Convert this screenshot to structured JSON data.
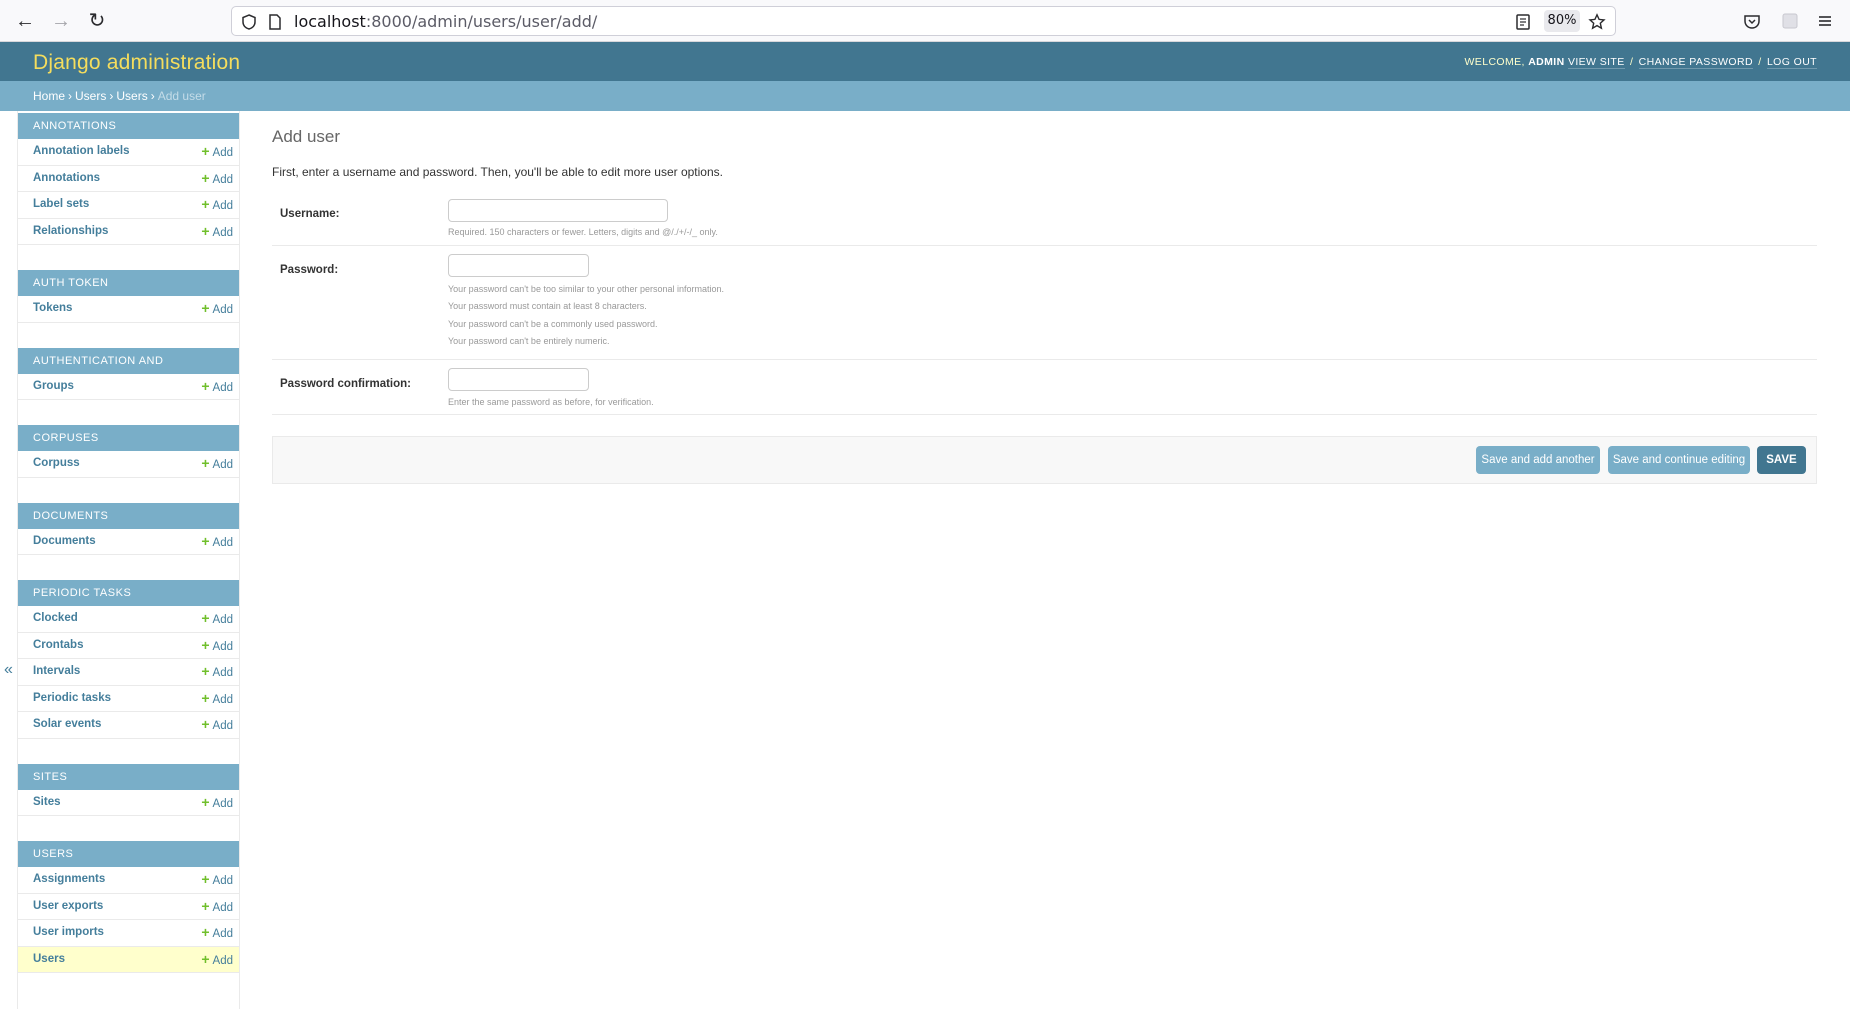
{
  "browser": {
    "url_host": "localhost",
    "url_path": ":8000/admin/users/user/add/",
    "zoom": "80%"
  },
  "header": {
    "branding": "Django administration",
    "welcome": "WELCOME,",
    "username": "ADMIN",
    "view_site": "VIEW SITE",
    "change_password": "CHANGE PASSWORD",
    "log_out": "LOG OUT",
    "sep": "/"
  },
  "breadcrumbs": {
    "home": "Home",
    "app": "Users",
    "model": "Users",
    "current": "Add user",
    "sep": "›"
  },
  "sidebar": {
    "collapse_glyph": "«",
    "add_label": "Add",
    "modules": [
      {
        "caption": "ANNOTATIONS",
        "items": [
          "Annotation labels",
          "Annotations",
          "Label sets",
          "Relationships"
        ]
      },
      {
        "caption": "AUTH TOKEN",
        "items": [
          "Tokens"
        ]
      },
      {
        "caption": "AUTHENTICATION AND AUTHORIZATION",
        "items": [
          "Groups"
        ]
      },
      {
        "caption": "CORPUSES",
        "items": [
          "Corpuss"
        ]
      },
      {
        "caption": "DOCUMENTS",
        "items": [
          "Documents"
        ]
      },
      {
        "caption": "PERIODIC TASKS",
        "items": [
          "Clocked",
          "Crontabs",
          "Intervals",
          "Periodic tasks",
          "Solar events"
        ]
      },
      {
        "caption": "SITES",
        "items": [
          "Sites"
        ]
      },
      {
        "caption": "USERS",
        "items": [
          "Assignments",
          "User exports",
          "User imports",
          "Users"
        ]
      }
    ],
    "current_item": "Users"
  },
  "main": {
    "title": "Add user",
    "intro": "First, enter a username and password. Then, you'll be able to edit more user options.",
    "username": {
      "label": "Username:",
      "value": "",
      "help": "Required. 150 characters or fewer. Letters, digits and @/./+/-/_ only."
    },
    "password": {
      "label": "Password:",
      "value": "",
      "help": [
        "Your password can't be too similar to your other personal information.",
        "Your password must contain at least 8 characters.",
        "Your password can't be a commonly used password.",
        "Your password can't be entirely numeric."
      ]
    },
    "password_confirmation": {
      "label": "Password confirmation:",
      "value": "",
      "help": "Enter the same password as before, for verification."
    },
    "buttons": {
      "save_add_another": "Save and add another",
      "save_continue": "Save and continue editing",
      "save": "SAVE"
    }
  },
  "colors": {
    "header_bg": "#417690",
    "branding": "#f5dd5d",
    "breadcrumbs_bg": "#79aec8",
    "module_caption_bg": "#79aec8",
    "link": "#447e9b",
    "add_plus": "#70bf2b",
    "current_row_bg": "#ffffcc",
    "save_button": "#417690"
  }
}
